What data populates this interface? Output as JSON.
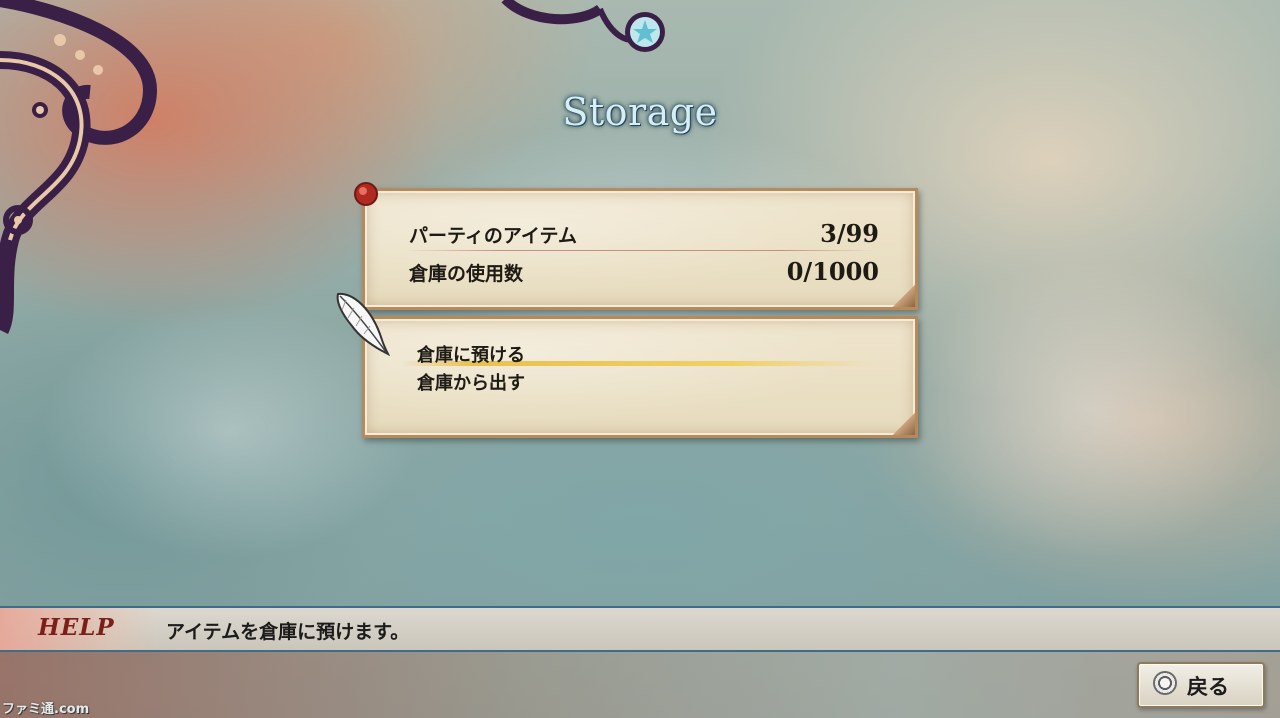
{
  "screen": {
    "title": "Storage"
  },
  "info": {
    "party_items_label": "パーティのアイテム",
    "party_items_value": "3/99",
    "storage_used_label": "倉庫の使用数",
    "storage_used_value": "0/1000"
  },
  "menu": {
    "items": [
      {
        "label": "倉庫に預ける",
        "selected": true
      },
      {
        "label": "倉庫から出す",
        "selected": false
      }
    ]
  },
  "help": {
    "label": "HELP",
    "text": "アイテムを倉庫に預けます。"
  },
  "footer": {
    "back_button_icon": "circle-button-icon",
    "back_button_label": "戻る"
  },
  "watermark": "ファミ通.com",
  "colors": {
    "title_text": "#d7eef4",
    "panel_parchment": "#efe5cd",
    "panel_border": "#b58a5e",
    "help_label": "#7b1f1a",
    "selection_highlight": "#e8be46",
    "help_bar_border": "#3f6c86"
  }
}
